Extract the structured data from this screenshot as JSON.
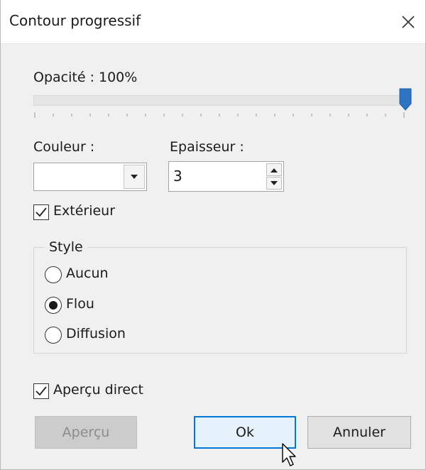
{
  "window": {
    "title": "Contour progressif"
  },
  "opacity": {
    "label": "Opacité : 100%",
    "value_percent": 100
  },
  "color": {
    "label": "Couleur :",
    "value_color": "#ffffff"
  },
  "thickness": {
    "label": "Epaisseur :",
    "value": "3"
  },
  "exterior": {
    "label": "Extérieur",
    "checked": true
  },
  "style": {
    "legend": "Style",
    "options": [
      {
        "label": "Aucun",
        "selected": false
      },
      {
        "label": "Flou",
        "selected": true
      },
      {
        "label": "Diffusion",
        "selected": false
      }
    ]
  },
  "live_preview": {
    "label": "Aperçu direct",
    "checked": true
  },
  "buttons": {
    "preview": "Aperçu",
    "ok": "Ok",
    "cancel": "Annuler"
  },
  "colors": {
    "accent": "#0078d7",
    "thumb": "#2f74c0"
  }
}
